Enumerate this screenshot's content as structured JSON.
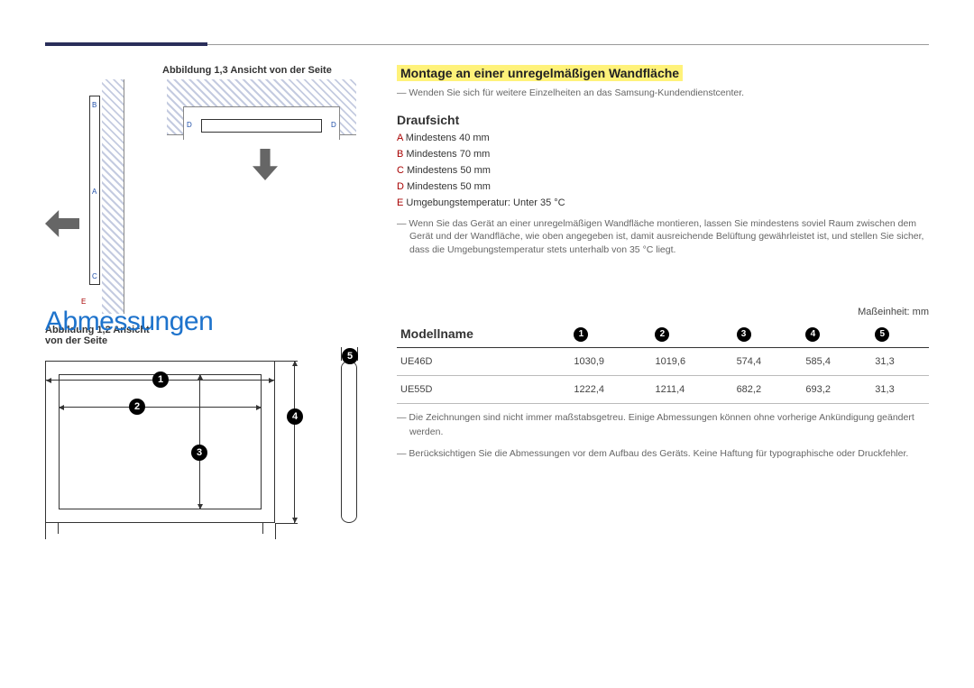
{
  "captions": {
    "abb13": "Abbildung 1,3 Ansicht von der Seite",
    "abb12": "Abbildung 1,2 Ansicht von der Seite"
  },
  "markers": {
    "A": "A",
    "B": "B",
    "C": "C",
    "D": "D",
    "E": "E"
  },
  "irregular": {
    "heading": "Montage an einer unregelmäßigen Wandfläche",
    "contact_note": "Wenden Sie sich für weitere Einzelheiten an das Samsung-Kundendienstcenter.",
    "topview": "Draufsicht",
    "specA": "Mindestens 40 mm",
    "specB": "Mindestens 70 mm",
    "specC": "Mindestens 50 mm",
    "specD": "Mindestens 50 mm",
    "specE": "Umgebungstemperatur: Unter 35 °C",
    "vent_note": "Wenn Sie das Gerät an einer unregelmäßigen Wandfläche montieren, lassen Sie mindestens soviel Raum zwischen dem Gerät und der Wandfläche, wie oben angegeben ist, damit ausreichende Belüftung gewährleistet ist, und stellen Sie sicher, dass die Umgebungstemperatur stets unterhalb von 35 °C liegt."
  },
  "dims": {
    "heading": "Abmessungen",
    "unit": "Maßeinheit: mm",
    "colhead": "Modellname",
    "rows": [
      {
        "model": "UE46D",
        "c1": "1030,9",
        "c2": "1019,6",
        "c3": "574,4",
        "c4": "585,4",
        "c5": "31,3"
      },
      {
        "model": "UE55D",
        "c1": "1222,4",
        "c2": "1211,4",
        "c3": "682,2",
        "c4": "693,2",
        "c5": "31,3"
      }
    ],
    "foot1": "Die Zeichnungen sind nicht immer maßstabsgetreu. Einige Abmessungen können ohne vorherige Ankündigung geändert werden.",
    "foot2": "Berücksichtigen Sie die Abmessungen vor dem Aufbau des Geräts. Keine Haftung für typographische oder Druckfehler."
  }
}
